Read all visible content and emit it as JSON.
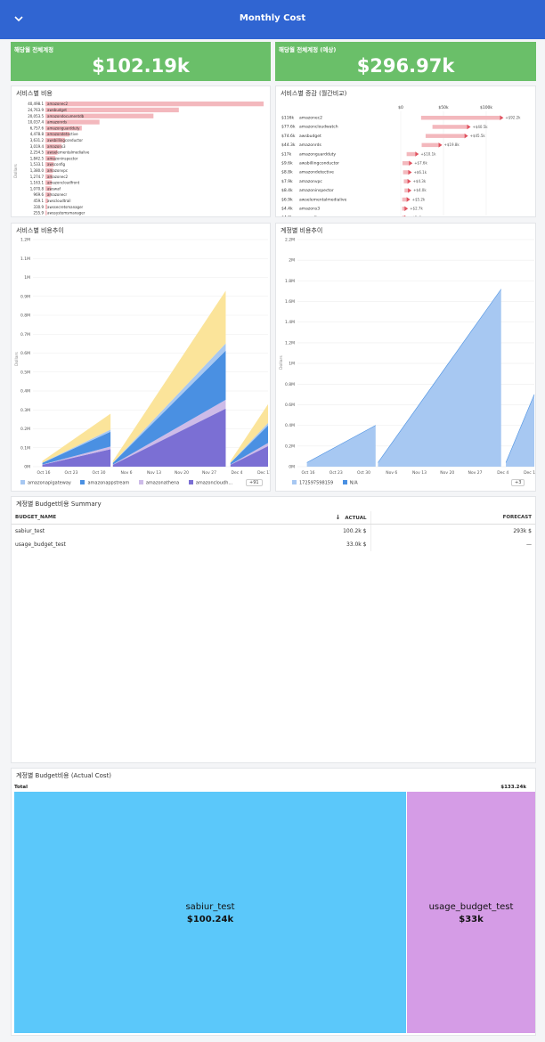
{
  "header": {
    "title": "Monthly Cost"
  },
  "kpis": [
    {
      "label": "해당월 전체계정",
      "value": "$102.19k"
    },
    {
      "label": "해당월 전체계정 (예상)",
      "value": "$296.97k"
    }
  ],
  "service_cost": {
    "title": "서비스별 비용",
    "ylabel": "Dollars",
    "rows": [
      {
        "value": "40,498.1",
        "label": "amazonec2",
        "amount": 40498.1
      },
      {
        "value": "24,763.9",
        "label": "awsbudget",
        "amount": 24763.9
      },
      {
        "value": "20,053.5",
        "label": "amazondocumentdb",
        "amount": 20053.5
      },
      {
        "value": "10,037.4",
        "label": "amazonrds",
        "amount": 10037.4
      },
      {
        "value": "6,757.6",
        "label": "amazonguardduty",
        "amount": 6757.6
      },
      {
        "value": "4,478.8",
        "label": "amazondetective",
        "amount": 4478.8
      },
      {
        "value": "3,631.2",
        "label": "awsbillingconductor",
        "amount": 3631.2
      },
      {
        "value": "3,019.4",
        "label": "amazons3",
        "amount": 3019.4
      },
      {
        "value": "2,254.5",
        "label": "awselementalmedialive",
        "amount": 2254.5
      },
      {
        "value": "1,842.5",
        "label": "amazoninspector",
        "amount": 1842.5
      },
      {
        "value": "1,533.1",
        "label": "awsconfig",
        "amount": 1533.1
      },
      {
        "value": "1,380.0",
        "label": "amazonvpc",
        "amount": 1380.0
      },
      {
        "value": "1,274.7",
        "label": "amazonec2",
        "amount": 1274.7
      },
      {
        "value": "1,163.1",
        "label": "amazoncloudfront",
        "amount": 1163.1
      },
      {
        "value": "1,070.8",
        "label": "awswaf",
        "amount": 1070.8
      },
      {
        "value": "969.6",
        "label": "amazonecr",
        "amount": 969.6
      },
      {
        "value": "459.1",
        "label": "awscloudtrail",
        "amount": 459.1
      },
      {
        "value": "330.9",
        "label": "awssecretsmanager",
        "amount": 330.9
      },
      {
        "value": "255.9",
        "label": "awssystemsmanager",
        "amount": 255.9
      }
    ]
  },
  "service_delta": {
    "title": "서비스별 증감 (월간비교)",
    "axis": [
      "$0",
      "$50k",
      "$100k"
    ],
    "rows": [
      {
        "total": "$116k",
        "label": "amazonec2",
        "delta": "+$92.2k",
        "d": 92.2
      },
      {
        "total": "$77.6k",
        "label": "amazoncloudwatch",
        "delta": "+$40.5k",
        "d": 40.5
      },
      {
        "total": "$74.6k",
        "label": "awsbudget",
        "delta": "+$45.5k",
        "d": 45.5
      },
      {
        "total": "$44.3k",
        "label": "amazonrds",
        "delta": "+$19.8k",
        "d": 19.8
      },
      {
        "total": "$17k",
        "label": "amazonguardduty",
        "delta": "+$10.1k",
        "d": 10.1
      },
      {
        "total": "$9.6k",
        "label": "awsbillingconductor",
        "delta": "+$7.6k",
        "d": 7.6
      },
      {
        "total": "$8.8k",
        "label": "amazondetective",
        "delta": "+$6.1k",
        "d": 6.1
      },
      {
        "total": "$7.9k",
        "label": "amazonvpc",
        "delta": "+$4.3k",
        "d": 4.3
      },
      {
        "total": "$8.4k",
        "label": "amazoninspector",
        "delta": "+$4.0k",
        "d": 4.0
      },
      {
        "total": "$6.9k",
        "label": "awselementalmedialive",
        "delta": "+$5.2k",
        "d": 5.2
      },
      {
        "total": "$4.4k",
        "label": "amazons3",
        "delta": "+$2.7k",
        "d": 2.7
      },
      {
        "total": "$4.2k",
        "label": "awsconfig",
        "delta": "+$2.4k",
        "d": 2.4
      }
    ]
  },
  "service_trend": {
    "title": "서비스별 비용추이",
    "ylabel": "Dollars",
    "yticks": [
      "0M",
      "0.1M",
      "0.2M",
      "0.3M",
      "0.4M",
      "0.5M",
      "0.6M",
      "0.7M",
      "0.8M",
      "0.9M",
      "1M",
      "1.1M",
      "1.2M"
    ],
    "xticks": [
      "Oct 16",
      "Oct 23",
      "Oct 30",
      "Nov 6",
      "Nov 13",
      "Nov 20",
      "Nov 27",
      "Dec 4",
      "Dec 11"
    ],
    "legend": [
      {
        "name": "amazonapigateway",
        "color": "#a7c8f2"
      },
      {
        "name": "amazonappstream",
        "color": "#4a90e2"
      },
      {
        "name": "amazonathena",
        "color": "#cdbbe8"
      },
      {
        "name": "amazoncloudh...",
        "color": "#7b6fd4"
      }
    ],
    "more": "+91"
  },
  "account_trend": {
    "title": "계정별 비용추이",
    "ylabel": "Dollars",
    "yticks": [
      "0M",
      "0.2M",
      "0.4M",
      "0.6M",
      "0.8M",
      "1M",
      "1.2M",
      "1.4M",
      "1.6M",
      "1.8M",
      "2M",
      "2.2M"
    ],
    "xticks": [
      "Oct 16",
      "Oct 23",
      "Oct 30",
      "Nov 6",
      "Nov 13",
      "Nov 20",
      "Nov 27",
      "Dec 4",
      "Dec 11"
    ],
    "legend": [
      {
        "name": "172597598159",
        "color": "#a7c8f2"
      },
      {
        "name": "N/A",
        "color": "#4a90e2"
      }
    ],
    "more": "+3"
  },
  "budget_summary": {
    "title": "계정별 Budget비용 Summary",
    "columns": {
      "name": "BUDGET_NAME",
      "actual": "ACTUAL",
      "forecast": "FORECAST"
    },
    "rows": [
      {
        "name": "sabiur_test",
        "actual": "100.2k $",
        "forecast": "293k $"
      },
      {
        "name": "usage_budget_test",
        "actual": "33.0k $",
        "forecast": "—"
      }
    ]
  },
  "budget_treemap": {
    "title": "계정별 Budget비용 (Actual Cost)",
    "total_label": "Total",
    "total_value": "$133.24k",
    "items": [
      {
        "name": "sabiur_test",
        "value": "$100.24k",
        "amount": 100.24,
        "color": "#5bc8fa"
      },
      {
        "name": "usage_budget_test",
        "value": "$33k",
        "amount": 33,
        "color": "#d59ce6"
      }
    ]
  }
}
